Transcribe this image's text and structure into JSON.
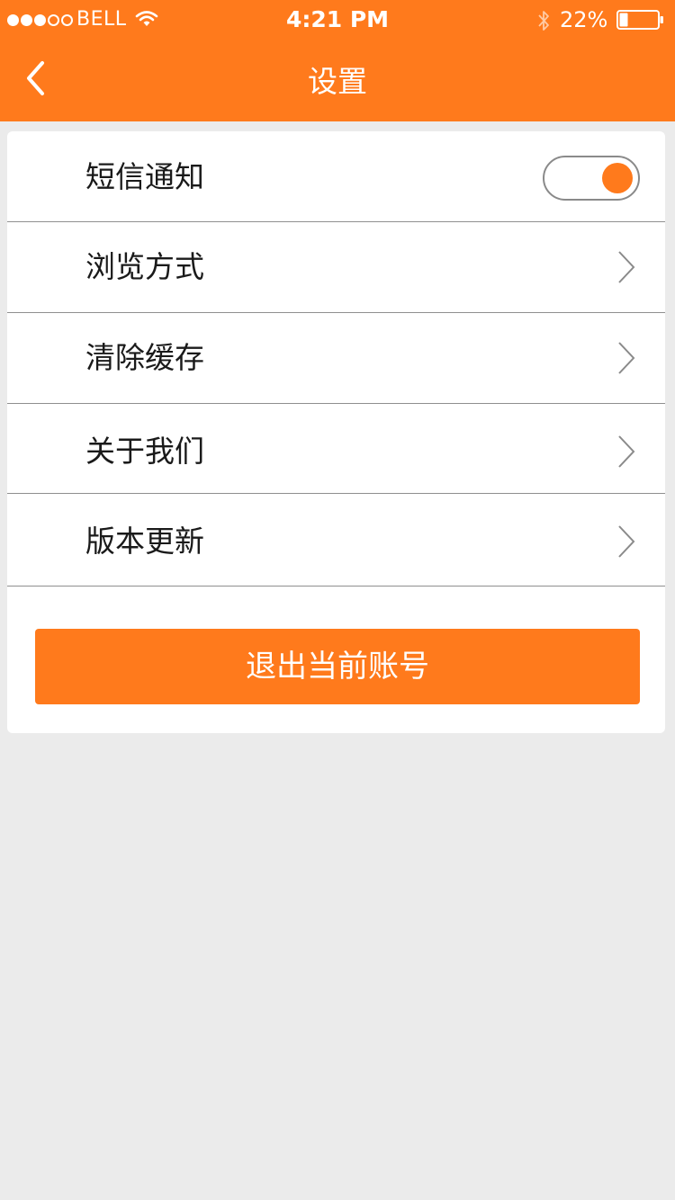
{
  "colors": {
    "accent": "#ff7a1c",
    "background": "#ebebeb",
    "card": "#ffffff",
    "divider": "#8f8f8f"
  },
  "status_bar": {
    "carrier": "BELL",
    "signal_bars_filled": 3,
    "signal_bars_total": 5,
    "time": "4:21 PM",
    "battery_percent": "22%",
    "battery_level": 0.22,
    "icons": [
      "wifi-icon",
      "bluetooth-icon",
      "battery-icon"
    ]
  },
  "nav": {
    "back_icon": "chevron-left-icon",
    "title": "设置"
  },
  "settings": {
    "sms_notification": {
      "label": "短信通知",
      "enabled": true
    },
    "items": [
      {
        "label": "浏览方式",
        "icon": "chevron-right-icon"
      },
      {
        "label": "清除缓存",
        "icon": "chevron-right-icon"
      },
      {
        "label": "关于我们",
        "icon": "chevron-right-icon"
      },
      {
        "label": "版本更新",
        "icon": "chevron-right-icon"
      }
    ]
  },
  "logout": {
    "label": "退出当前账号"
  }
}
